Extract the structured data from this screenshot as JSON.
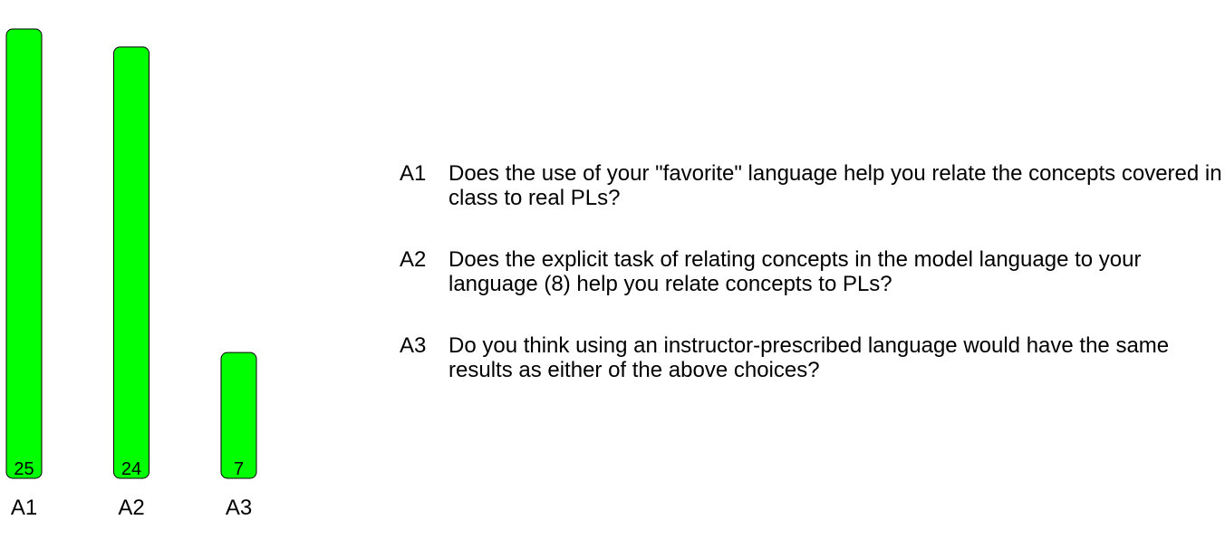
{
  "chart_data": {
    "type": "bar",
    "categories": [
      "A1",
      "A2",
      "A3"
    ],
    "values": [
      25,
      24,
      7
    ],
    "data_labels": [
      "25",
      "24",
      "7"
    ],
    "bar_color": "#00ff00",
    "title": "",
    "xlabel": "",
    "ylabel": "",
    "ylim": [
      0,
      25
    ],
    "grid": false,
    "legend": [
      {
        "code": "A1",
        "text": "Does the use of your \"favorite\" language help you relate the concepts covered in class to real PLs?"
      },
      {
        "code": "A2",
        "text": "Does the explicit task of relating concepts in the model language to your language (8) help you relate concepts to PLs?"
      },
      {
        "code": "A3",
        "text": "Do you think using an instructor-prescribed language would have the same results as either of the above choices?"
      }
    ]
  }
}
